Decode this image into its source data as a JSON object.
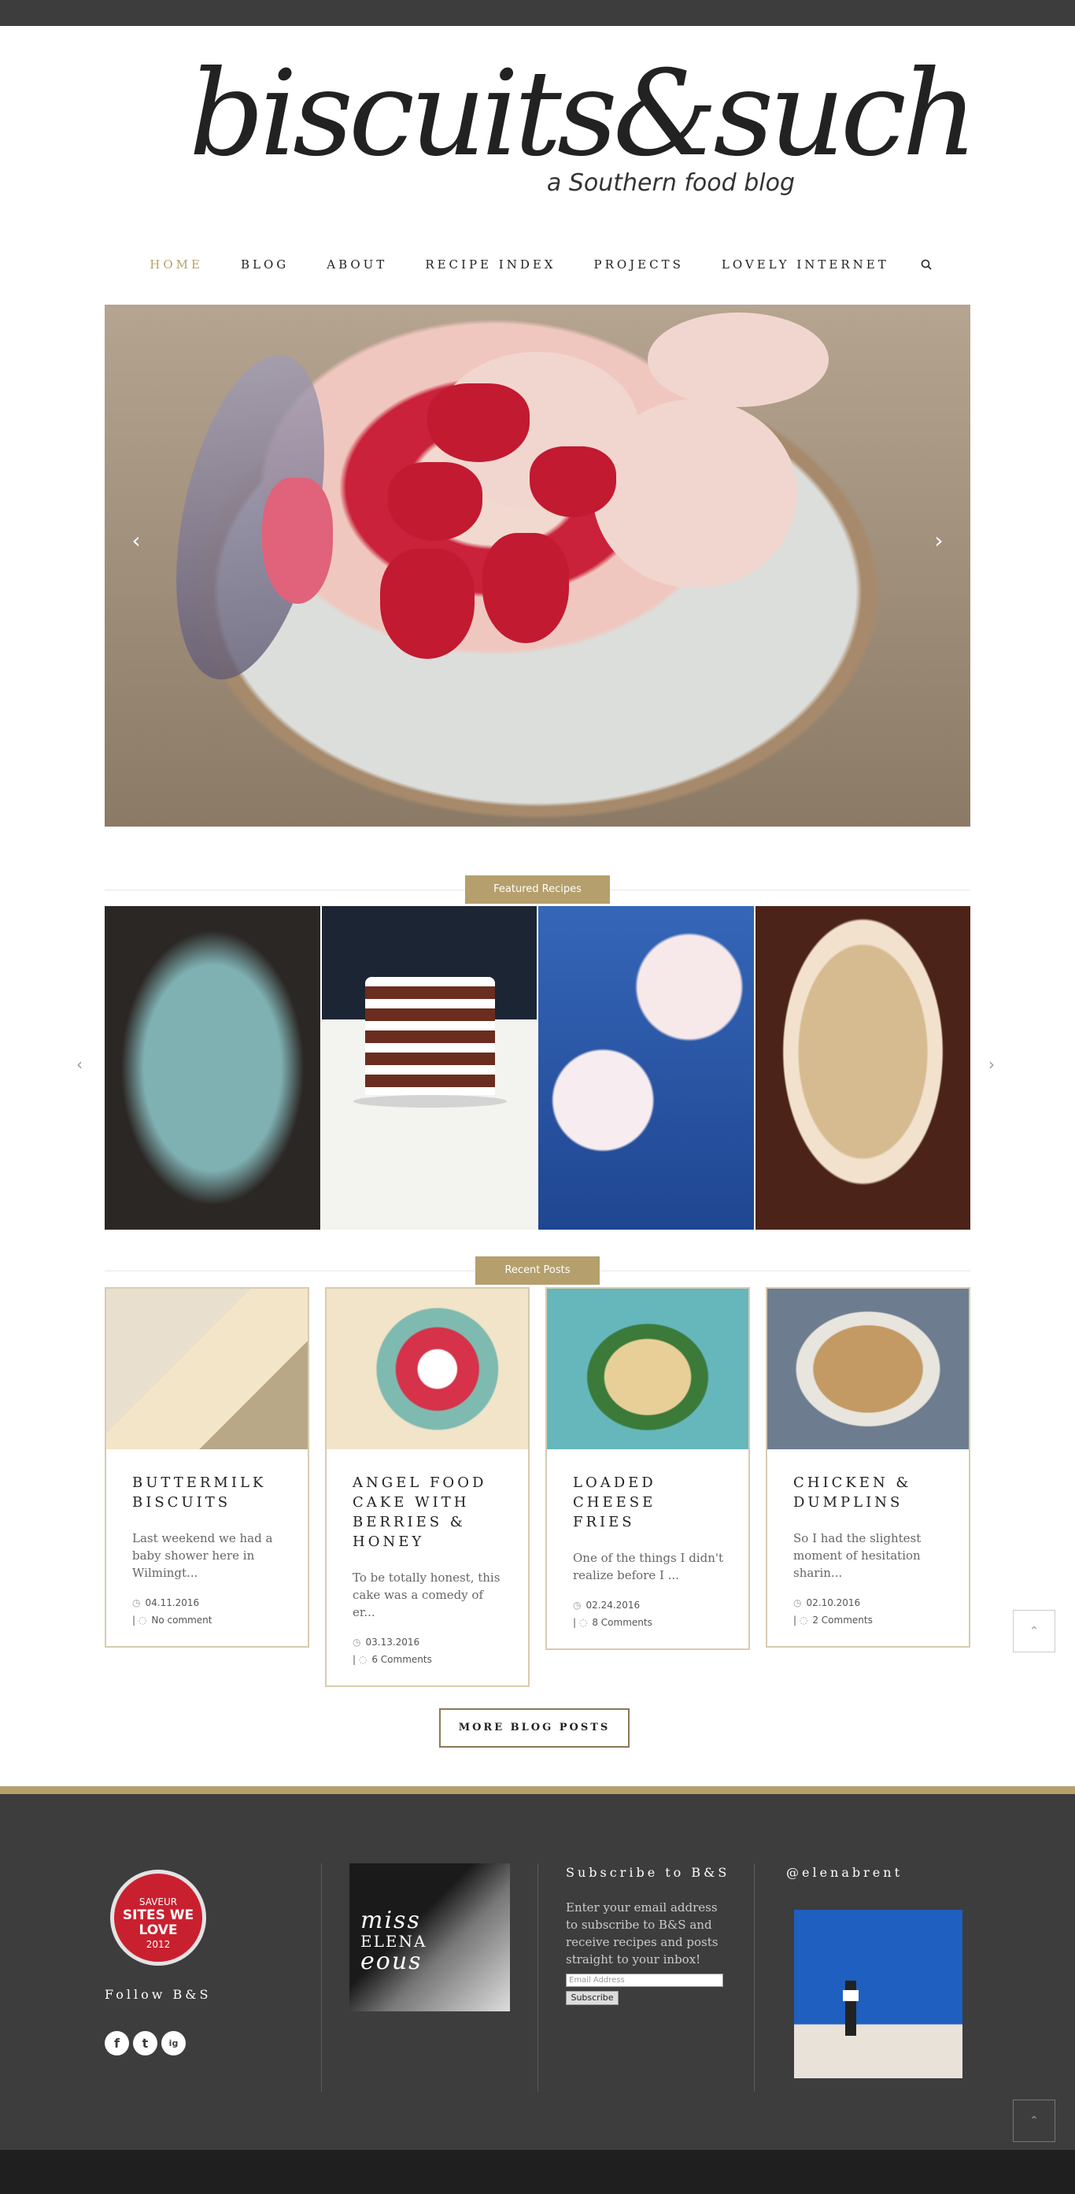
{
  "site": {
    "logo_text": "biscuits&such",
    "tagline": "a Southern food blog"
  },
  "nav": {
    "items": [
      {
        "label": "HOME"
      },
      {
        "label": "BLOG"
      },
      {
        "label": "ABOUT"
      },
      {
        "label": "RECIPE INDEX"
      },
      {
        "label": "PROJECTS"
      },
      {
        "label": "LOVELY INTERNET"
      }
    ],
    "search_icon": "search-icon",
    "active_color": "#b8a06b"
  },
  "hero": {
    "prev_arrow": "‹",
    "next_arrow": "›"
  },
  "featured": {
    "label": "Featured Recipes",
    "prev_arrow": "‹",
    "next_arrow": "›"
  },
  "recent": {
    "label": "Recent Posts",
    "posts": [
      {
        "title": "BUTTERMILK BISCUITS",
        "excerpt": "Last weekend we had a baby shower here in Wilmingt...",
        "date": "04.11.2016",
        "comments": "No comment"
      },
      {
        "title": "ANGEL FOOD CAKE WITH BERRIES & HONEY",
        "excerpt": "To be totally honest, this cake was a comedy of er...",
        "date": "03.13.2016",
        "comments": "6 Comments"
      },
      {
        "title": "LOADED CHEESE FRIES",
        "excerpt": "One of the things I didn't realize before I ...",
        "date": "02.24.2016",
        "comments": "8 Comments"
      },
      {
        "title": "CHICKEN & DUMPLINS",
        "excerpt": "So I had the slightest moment of hesitation sharin...",
        "date": "02.10.2016",
        "comments": "2 Comments"
      }
    ],
    "more_button": "MORE BLOG POSTS"
  },
  "footer": {
    "seal": {
      "line1": "SAVEUR",
      "line2": "SITES WE",
      "line3": "LOVE",
      "line4": "2012"
    },
    "follow_heading": "Follow B&S",
    "social": [
      "f",
      "t",
      "ig"
    ],
    "missel": {
      "line1": "miss",
      "line2": "ELENA",
      "line3": "eous"
    },
    "subscribe_heading": "Subscribe to B&S",
    "subscribe_text": "Enter your email address to subscribe to B&S and receive recipes and posts straight to your inbox!",
    "email_placeholder": "Email Address",
    "subscribe_button": "Subscribe",
    "instagram_heading": "@elenabrent"
  },
  "colors": {
    "accent": "#b59f6c",
    "dark": "#3d3d3e"
  }
}
